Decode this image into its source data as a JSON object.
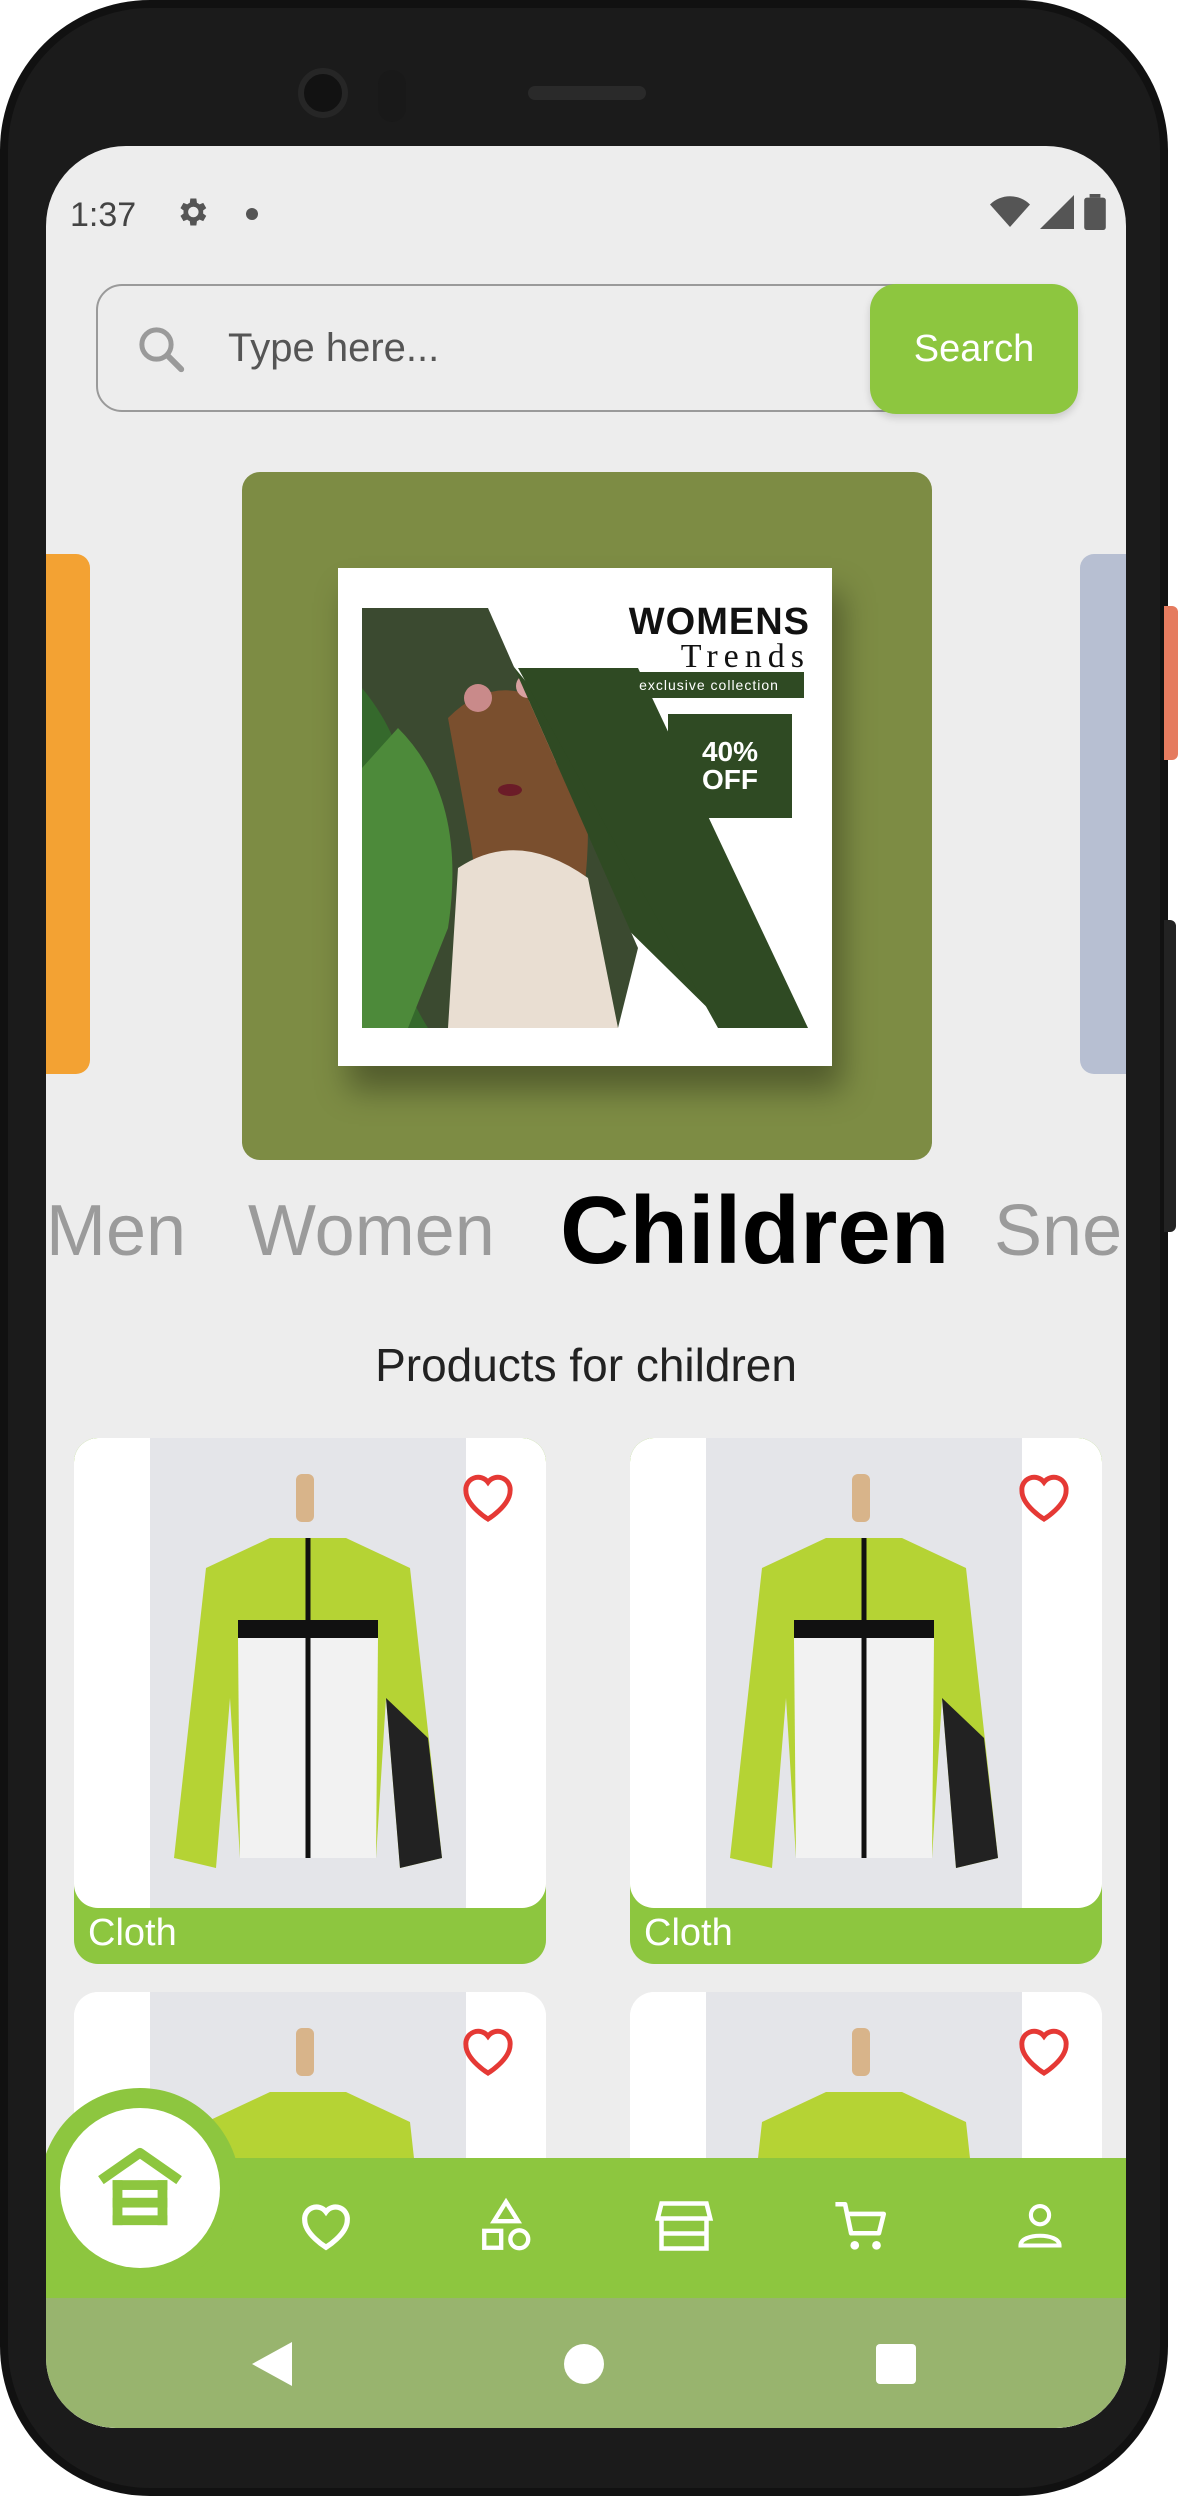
{
  "status_bar": {
    "time": "1:37"
  },
  "search": {
    "placeholder": "Type here...",
    "button_label": "Search"
  },
  "banner": {
    "title": "WOMENS",
    "subtitle": "Trends",
    "tagline": "exclusive collection",
    "discount_value": "40%",
    "discount_label": "OFF"
  },
  "categories": [
    {
      "label": "Men",
      "active": false
    },
    {
      "label": "Women",
      "active": false
    },
    {
      "label": "Children",
      "active": true
    },
    {
      "label": "Sne",
      "active": false
    }
  ],
  "section_title": "Products for children",
  "products": [
    {
      "label": "Cloth"
    },
    {
      "label": "Cloth"
    },
    {
      "label": ""
    },
    {
      "label": ""
    }
  ],
  "bottom_nav": {
    "items": [
      "home-icon",
      "heart-icon",
      "shapes-icon",
      "store-icon",
      "cart-icon",
      "person-icon"
    ],
    "active": "home-icon"
  },
  "colors": {
    "accent": "#8dc63f",
    "banner": "#7d8c44",
    "left_banner": "#f3a233",
    "right_banner": "#b7bfd2",
    "system_nav": "#98b46e",
    "heart": "#e53935"
  }
}
